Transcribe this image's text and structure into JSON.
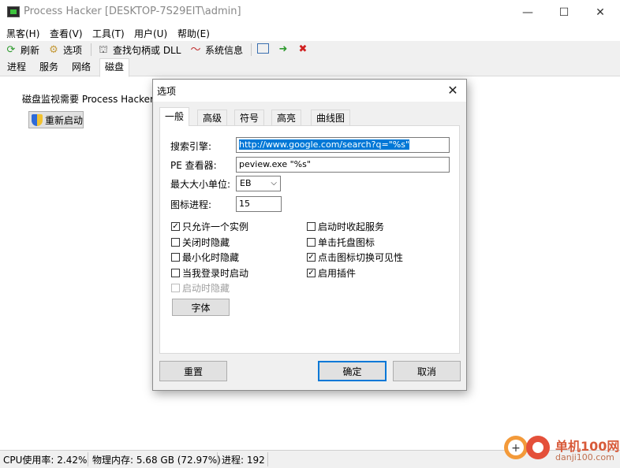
{
  "window": {
    "title": "Process Hacker [DESKTOP-7S29EIT\\admin]",
    "controls": {
      "minimize": "—",
      "maximize": "☐",
      "close": "✕"
    }
  },
  "menu": [
    "黑客(H)",
    "查看(V)",
    "工具(T)",
    "用户(U)",
    "帮助(E)"
  ],
  "toolbar": {
    "refresh_label": "刷新",
    "options_label": "选项",
    "find_label": "查找句柄或 DLL",
    "sysinfo_label": "系统信息"
  },
  "tabs": [
    "进程",
    "服务",
    "网络",
    "磁盘"
  ],
  "active_tab": "磁盘",
  "disk_tab": {
    "message": "磁盘监视需要 Process Hacker 以",
    "restart_label": "重新启动"
  },
  "status_bar": {
    "cpu": "CPU使用率: 2.42%",
    "memory": "物理内存: 5.68 GB (72.97%)",
    "processes": "进程: 192"
  },
  "dialog": {
    "title": "选项",
    "tabs": [
      "一般",
      "高级",
      "符号",
      "高亮",
      "曲线图"
    ],
    "active_tab": "一般",
    "search_engine_label": "搜索引擎:",
    "search_engine_value": "http://www.google.com/search?q=\"%s\"",
    "pe_viewer_label": "PE 查看器:",
    "pe_viewer_value": "peview.exe \"%s\"",
    "max_size_unit_label": "最大大小单位:",
    "max_size_unit_value": "EB",
    "icon_process_label": "图标进程:",
    "icon_process_value": "15",
    "checkboxes_left": [
      {
        "label": "只允许一个实例",
        "checked": true,
        "disabled": false
      },
      {
        "label": "关闭时隐藏",
        "checked": false,
        "disabled": false
      },
      {
        "label": "最小化时隐藏",
        "checked": false,
        "disabled": false
      },
      {
        "label": "当我登录时启动",
        "checked": false,
        "disabled": false
      },
      {
        "label": "启动时隐藏",
        "checked": false,
        "disabled": true
      }
    ],
    "checkboxes_right": [
      {
        "label": "启动时收起服务",
        "checked": false
      },
      {
        "label": "单击托盘图标",
        "checked": false
      },
      {
        "label": "点击图标切换可见性",
        "checked": true
      },
      {
        "label": "启用插件",
        "checked": true
      }
    ],
    "font_button": "字体",
    "reset_button": "重置",
    "ok_button": "确定",
    "cancel_button": "取消"
  },
  "watermark": {
    "name": "单机100网",
    "url": "danji100.com"
  }
}
